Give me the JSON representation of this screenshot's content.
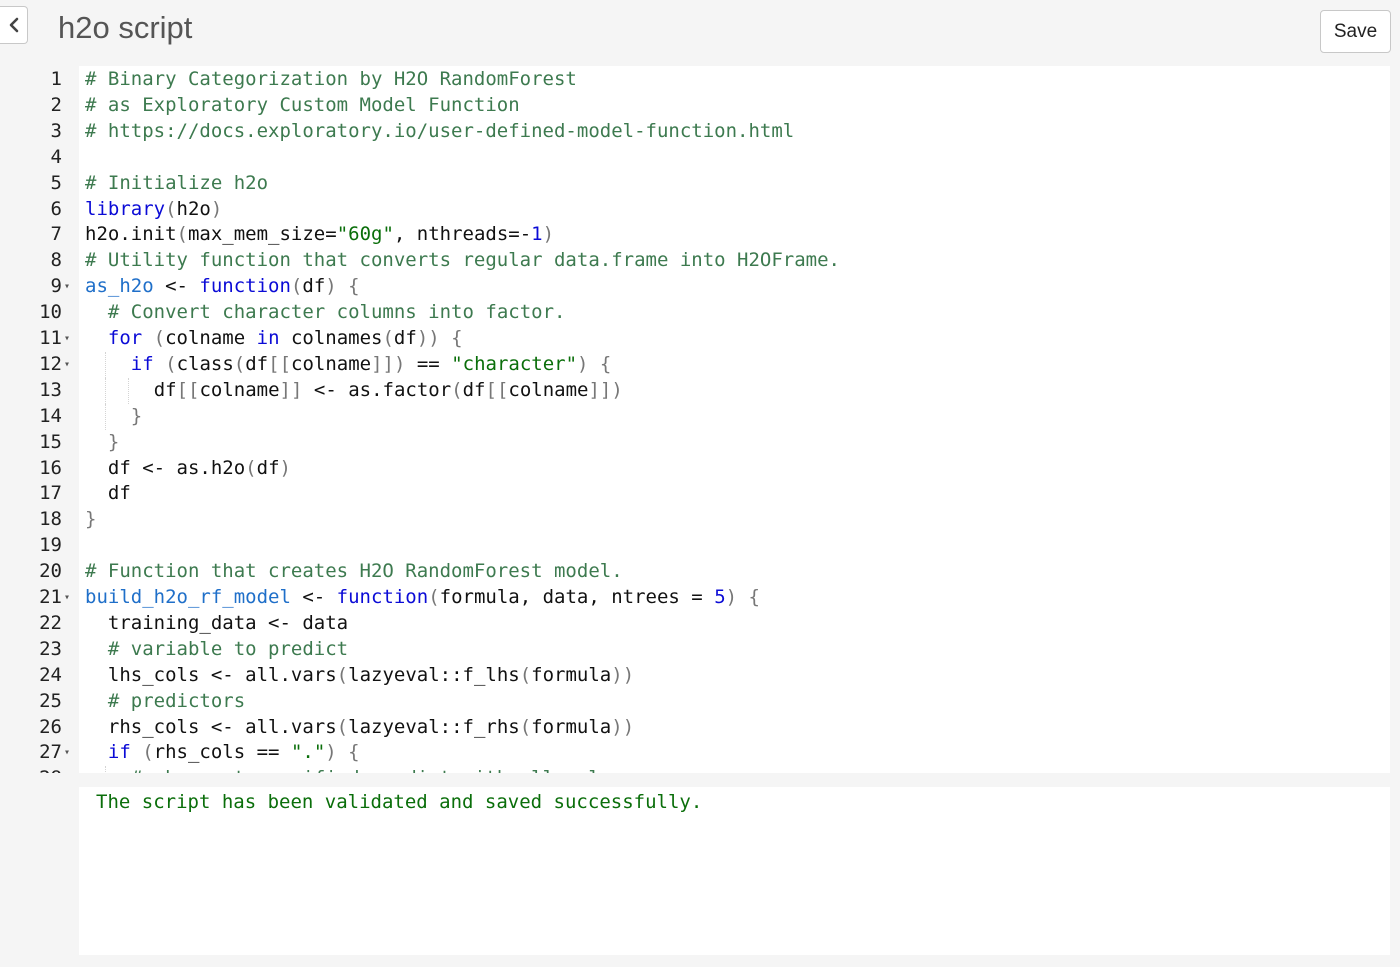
{
  "header": {
    "title": "h2o script",
    "save_label": "Save"
  },
  "console": {
    "message": "The script has been validated and saved successfully."
  },
  "editor": {
    "lines": [
      {
        "n": "1",
        "fold": false,
        "indent": 0,
        "tokens": [
          {
            "t": "# Binary Categorization by H2O RandomForest",
            "c": "comment"
          }
        ]
      },
      {
        "n": "2",
        "fold": false,
        "indent": 0,
        "tokens": [
          {
            "t": "# as Exploratory Custom Model Function",
            "c": "comment"
          }
        ]
      },
      {
        "n": "3",
        "fold": false,
        "indent": 0,
        "tokens": [
          {
            "t": "# https://docs.exploratory.io/user-defined-model-function.html",
            "c": "comment"
          }
        ]
      },
      {
        "n": "4",
        "fold": false,
        "indent": 0,
        "tokens": []
      },
      {
        "n": "5",
        "fold": false,
        "indent": 0,
        "tokens": [
          {
            "t": "# Initialize h2o",
            "c": "comment"
          }
        ]
      },
      {
        "n": "6",
        "fold": false,
        "indent": 0,
        "tokens": [
          {
            "t": "library",
            "c": "keyword"
          },
          {
            "t": "(",
            "c": "paren"
          },
          {
            "t": "h2o",
            "c": "plain"
          },
          {
            "t": ")",
            "c": "paren"
          }
        ]
      },
      {
        "n": "7",
        "fold": false,
        "indent": 0,
        "tokens": [
          {
            "t": "h2o.init",
            "c": "plain"
          },
          {
            "t": "(",
            "c": "paren"
          },
          {
            "t": "max_mem_size=",
            "c": "plain"
          },
          {
            "t": "\"60g\"",
            "c": "string"
          },
          {
            "t": ", nthreads=-",
            "c": "plain"
          },
          {
            "t": "1",
            "c": "number"
          },
          {
            "t": ")",
            "c": "paren"
          }
        ]
      },
      {
        "n": "8",
        "fold": false,
        "indent": 0,
        "tokens": [
          {
            "t": "# Utility function that converts regular data.frame into H2OFrame.",
            "c": "comment"
          }
        ]
      },
      {
        "n": "9",
        "fold": true,
        "indent": 0,
        "tokens": [
          {
            "t": "as_h2o",
            "c": "def"
          },
          {
            "t": " <- ",
            "c": "plain"
          },
          {
            "t": "function",
            "c": "keyword"
          },
          {
            "t": "(",
            "c": "paren"
          },
          {
            "t": "df",
            "c": "plain"
          },
          {
            "t": ") {",
            "c": "paren"
          }
        ]
      },
      {
        "n": "10",
        "fold": false,
        "indent": 1,
        "tokens": [
          {
            "t": "# Convert character columns into factor.",
            "c": "comment"
          }
        ]
      },
      {
        "n": "11",
        "fold": true,
        "indent": 1,
        "tokens": [
          {
            "t": "for",
            "c": "keyword"
          },
          {
            "t": " (",
            "c": "paren"
          },
          {
            "t": "colname ",
            "c": "plain"
          },
          {
            "t": "in",
            "c": "keyword"
          },
          {
            "t": " colnames",
            "c": "plain"
          },
          {
            "t": "(",
            "c": "paren"
          },
          {
            "t": "df",
            "c": "plain"
          },
          {
            "t": ")) {",
            "c": "paren"
          }
        ]
      },
      {
        "n": "12",
        "fold": true,
        "indent": 2,
        "tokens": [
          {
            "t": "if",
            "c": "keyword"
          },
          {
            "t": " (",
            "c": "paren"
          },
          {
            "t": "class",
            "c": "plain"
          },
          {
            "t": "(",
            "c": "paren"
          },
          {
            "t": "df",
            "c": "plain"
          },
          {
            "t": "[[",
            "c": "paren"
          },
          {
            "t": "colname",
            "c": "plain"
          },
          {
            "t": "]])",
            "c": "paren"
          },
          {
            "t": " == ",
            "c": "plain"
          },
          {
            "t": "\"character\"",
            "c": "string"
          },
          {
            "t": ") {",
            "c": "paren"
          }
        ]
      },
      {
        "n": "13",
        "fold": false,
        "indent": 3,
        "tokens": [
          {
            "t": "df",
            "c": "plain"
          },
          {
            "t": "[[",
            "c": "paren"
          },
          {
            "t": "colname",
            "c": "plain"
          },
          {
            "t": "]]",
            "c": "paren"
          },
          {
            "t": " <- as.factor",
            "c": "plain"
          },
          {
            "t": "(",
            "c": "paren"
          },
          {
            "t": "df",
            "c": "plain"
          },
          {
            "t": "[[",
            "c": "paren"
          },
          {
            "t": "colname",
            "c": "plain"
          },
          {
            "t": "]])",
            "c": "paren"
          }
        ]
      },
      {
        "n": "14",
        "fold": false,
        "indent": 2,
        "tokens": [
          {
            "t": "}",
            "c": "paren"
          }
        ]
      },
      {
        "n": "15",
        "fold": false,
        "indent": 1,
        "tokens": [
          {
            "t": "}",
            "c": "paren"
          }
        ]
      },
      {
        "n": "16",
        "fold": false,
        "indent": 1,
        "tokens": [
          {
            "t": "df <- as.h2o",
            "c": "plain"
          },
          {
            "t": "(",
            "c": "paren"
          },
          {
            "t": "df",
            "c": "plain"
          },
          {
            "t": ")",
            "c": "paren"
          }
        ]
      },
      {
        "n": "17",
        "fold": false,
        "indent": 1,
        "tokens": [
          {
            "t": "df",
            "c": "plain"
          }
        ]
      },
      {
        "n": "18",
        "fold": false,
        "indent": 0,
        "tokens": [
          {
            "t": "}",
            "c": "paren"
          }
        ]
      },
      {
        "n": "19",
        "fold": false,
        "indent": 0,
        "tokens": []
      },
      {
        "n": "20",
        "fold": false,
        "indent": 0,
        "tokens": [
          {
            "t": "# Function that creates H2O RandomForest model.",
            "c": "comment"
          }
        ]
      },
      {
        "n": "21",
        "fold": true,
        "indent": 0,
        "tokens": [
          {
            "t": "build_h2o_rf_model",
            "c": "def"
          },
          {
            "t": " <- ",
            "c": "plain"
          },
          {
            "t": "function",
            "c": "keyword"
          },
          {
            "t": "(",
            "c": "paren"
          },
          {
            "t": "formula, data, ntrees = ",
            "c": "plain"
          },
          {
            "t": "5",
            "c": "number"
          },
          {
            "t": ") {",
            "c": "paren"
          }
        ]
      },
      {
        "n": "22",
        "fold": false,
        "indent": 1,
        "tokens": [
          {
            "t": "training_data <- data",
            "c": "plain"
          }
        ]
      },
      {
        "n": "23",
        "fold": false,
        "indent": 1,
        "tokens": [
          {
            "t": "# variable to predict",
            "c": "comment"
          }
        ]
      },
      {
        "n": "24",
        "fold": false,
        "indent": 1,
        "tokens": [
          {
            "t": "lhs_cols <- all.vars",
            "c": "plain"
          },
          {
            "t": "(",
            "c": "paren"
          },
          {
            "t": "lazyeval::f_lhs",
            "c": "plain"
          },
          {
            "t": "(",
            "c": "paren"
          },
          {
            "t": "formula",
            "c": "plain"
          },
          {
            "t": "))",
            "c": "paren"
          }
        ]
      },
      {
        "n": "25",
        "fold": false,
        "indent": 1,
        "tokens": [
          {
            "t": "# predictors",
            "c": "comment"
          }
        ]
      },
      {
        "n": "26",
        "fold": false,
        "indent": 1,
        "tokens": [
          {
            "t": "rhs_cols <- all.vars",
            "c": "plain"
          },
          {
            "t": "(",
            "c": "paren"
          },
          {
            "t": "lazyeval::f_rhs",
            "c": "plain"
          },
          {
            "t": "(",
            "c": "paren"
          },
          {
            "t": "formula",
            "c": "plain"
          },
          {
            "t": "))",
            "c": "paren"
          }
        ]
      },
      {
        "n": "27",
        "fold": true,
        "indent": 1,
        "tokens": [
          {
            "t": "if",
            "c": "keyword"
          },
          {
            "t": " (",
            "c": "paren"
          },
          {
            "t": "rhs_cols == ",
            "c": "plain"
          },
          {
            "t": "\".\"",
            "c": "string"
          },
          {
            "t": ") {",
            "c": "paren"
          }
        ]
      },
      {
        "n": "28",
        "fold": false,
        "indent": 2,
        "tokens": [
          {
            "t": "# when not specified predict with all col",
            "c": "comment"
          }
        ]
      }
    ]
  },
  "icons": {
    "back": "chevron-left-icon",
    "fold": "fold-triangle-icon"
  },
  "colors": {
    "comment": "#3d7a4f",
    "keyword": "#0b0bd6",
    "string": "#0a6e0a",
    "console_text": "#0a6e0a"
  }
}
